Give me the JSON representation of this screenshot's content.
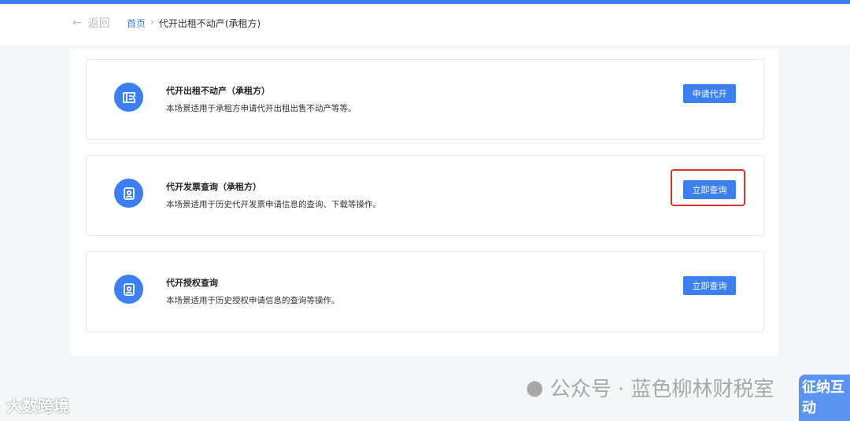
{
  "header": {
    "back_label": "返回",
    "breadcrumb": {
      "home": "首页",
      "current": "代开出租不动产(承租方)"
    }
  },
  "cards": [
    {
      "title": "代开出租不动产（承租方）",
      "desc": "本场景适用于承租方申请代开出租出售不动产等等。",
      "button": "申请代开",
      "icon": "ticket-icon",
      "highlighted": false
    },
    {
      "title": "代开发票查询（承租方）",
      "desc": "本场景适用于历史代开发票申请信息的查询、下载等操作。",
      "button": "立即查询",
      "icon": "profile-card-icon",
      "highlighted": true
    },
    {
      "title": "代开授权查询",
      "desc": "本场景适用于历史授权申请信息的查询等操作。",
      "button": "立即查询",
      "icon": "profile-card-icon",
      "highlighted": false
    }
  ],
  "watermarks": {
    "left": "大数跨境",
    "right": "公众号 · 蓝色柳林财税室",
    "mascot": "征纳互动"
  },
  "colors": {
    "accent": "#3b7ff0",
    "highlight": "#d9362b"
  }
}
